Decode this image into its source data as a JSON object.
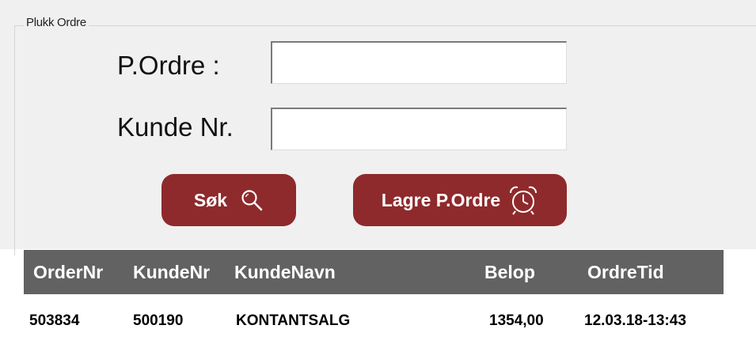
{
  "group": {
    "title": "Plukk Ordre"
  },
  "form": {
    "order_label": "P.Ordre :",
    "order_value": "",
    "customer_label": "Kunde Nr.",
    "customer_value": ""
  },
  "buttons": {
    "search_label": "Søk",
    "search_icon": "magnifier-icon",
    "save_label": "Lagre P.Ordre",
    "save_icon": "alarm-clock-icon",
    "color": "#8e2a2c"
  },
  "grid": {
    "header_color": "#626262",
    "columns": [
      "OrderNr",
      "KundeNr",
      "KundeNavn",
      "Belop",
      "OrdreTid"
    ],
    "rows": [
      [
        "503834",
        "500190",
        "KONTANTSALG",
        "1354,00",
        "12.03.18-13:43"
      ]
    ]
  }
}
